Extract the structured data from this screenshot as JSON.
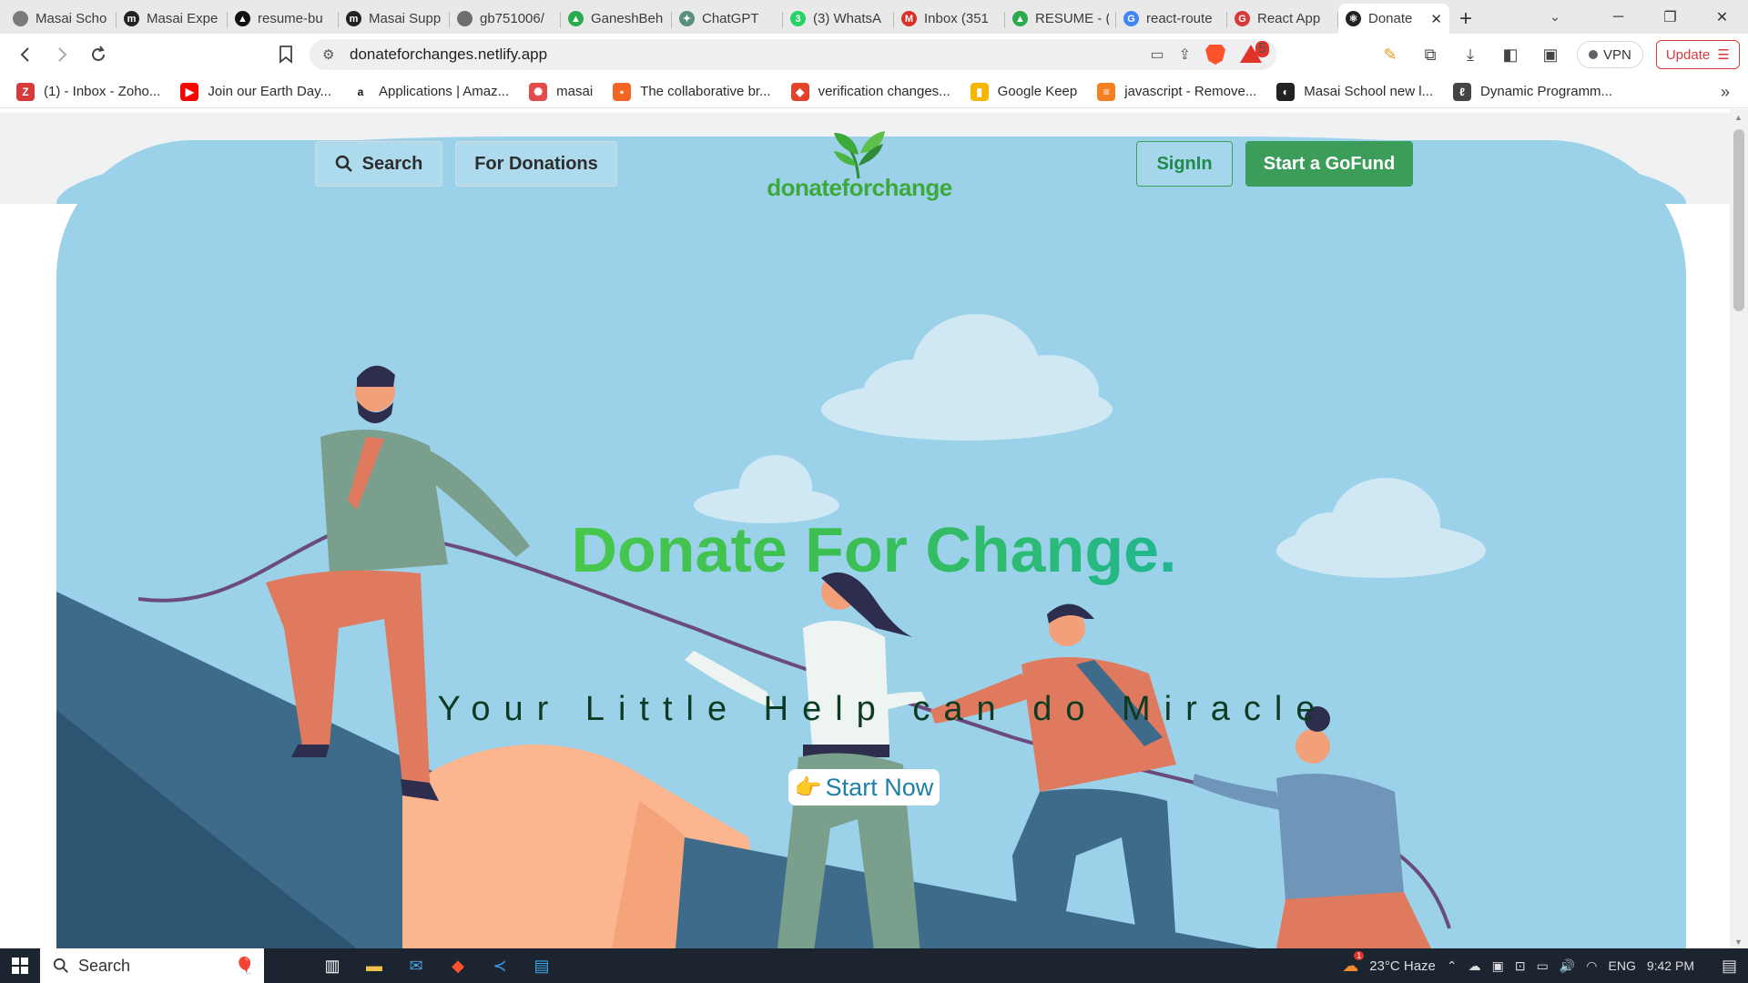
{
  "browser": {
    "tabs": [
      {
        "title": "Masai Scho",
        "icon_color": "#7a7a7a",
        "icon_glyph": ""
      },
      {
        "title": "Masai Expe",
        "icon_color": "#222222",
        "icon_glyph": "m"
      },
      {
        "title": "resume-bu",
        "icon_color": "#111111",
        "icon_glyph": "▲"
      },
      {
        "title": "Masai Supp",
        "icon_color": "#222222",
        "icon_glyph": "m"
      },
      {
        "title": "gb751006/",
        "icon_color": "#6e6e6e",
        "icon_glyph": ""
      },
      {
        "title": "GaneshBeh",
        "icon_color": "#2da94f",
        "icon_glyph": "▲"
      },
      {
        "title": "ChatGPT",
        "icon_color": "#5a8f7b",
        "icon_glyph": "✦"
      },
      {
        "title": "(3) WhatsA",
        "icon_color": "#25d366",
        "icon_glyph": "3"
      },
      {
        "title": "Inbox (351",
        "icon_color": "#d93025",
        "icon_glyph": "M"
      },
      {
        "title": "RESUME - (",
        "icon_color": "#2da94f",
        "icon_glyph": "▲"
      },
      {
        "title": "react-route",
        "icon_color": "#4285f4",
        "icon_glyph": "G"
      },
      {
        "title": "React App",
        "icon_color": "#d63a3a",
        "icon_glyph": "G"
      },
      {
        "title": "Donate",
        "icon_color": "#222222",
        "icon_glyph": "⚛",
        "active": true
      }
    ],
    "url": "donateforchanges.netlify.app",
    "vpn_label": "VPN",
    "update_label": "Update",
    "rewards_count": "5",
    "bookmarks": [
      {
        "label": "(1) - Inbox - Zoho...",
        "icon_color": "#d63a3a",
        "icon_glyph": "Z"
      },
      {
        "label": "Join our Earth Day...",
        "icon_color": "#ff0000",
        "icon_glyph": "▶"
      },
      {
        "label": "Applications | Amaz...",
        "icon_color": "#ffffff",
        "icon_glyph": "a"
      },
      {
        "label": "masai",
        "icon_color": "#e34b4b",
        "icon_glyph": "✺"
      },
      {
        "label": "The collaborative br...",
        "icon_color": "#f26522",
        "icon_glyph": "▪"
      },
      {
        "label": "verification changes...",
        "icon_color": "#e2432a",
        "icon_glyph": "◆"
      },
      {
        "label": "Google Keep",
        "icon_color": "#f7b500",
        "icon_glyph": "▮"
      },
      {
        "label": "javascript - Remove...",
        "icon_color": "#f48024",
        "icon_glyph": "≡"
      },
      {
        "label": "Masai School new l...",
        "icon_color": "#222222",
        "icon_glyph": "◐"
      },
      {
        "label": "Dynamic Programm...",
        "icon_color": "#444444",
        "icon_glyph": "ℓ"
      }
    ]
  },
  "site": {
    "nav": {
      "search_label": "Search",
      "donations_label": "For Donations",
      "logo_text": "donateforchange",
      "signin_label": "SignIn",
      "gofund_label": "Start a GoFund"
    },
    "hero": {
      "title": "Donate For Change.",
      "subtitle": "Your Little Help can do Miracle",
      "cta_label": "Start Now",
      "cta_icon": "👉"
    },
    "colors": {
      "sky": "#9bd2ea",
      "brand_green": "#3c9c59",
      "title_green": "#4cc94c",
      "subtitle": "#0d3b22"
    }
  },
  "taskbar": {
    "search_label": "Search",
    "weather": "23°C  Haze",
    "lang": "ENG",
    "time": "9:42 PM",
    "weather_badge": "1"
  }
}
